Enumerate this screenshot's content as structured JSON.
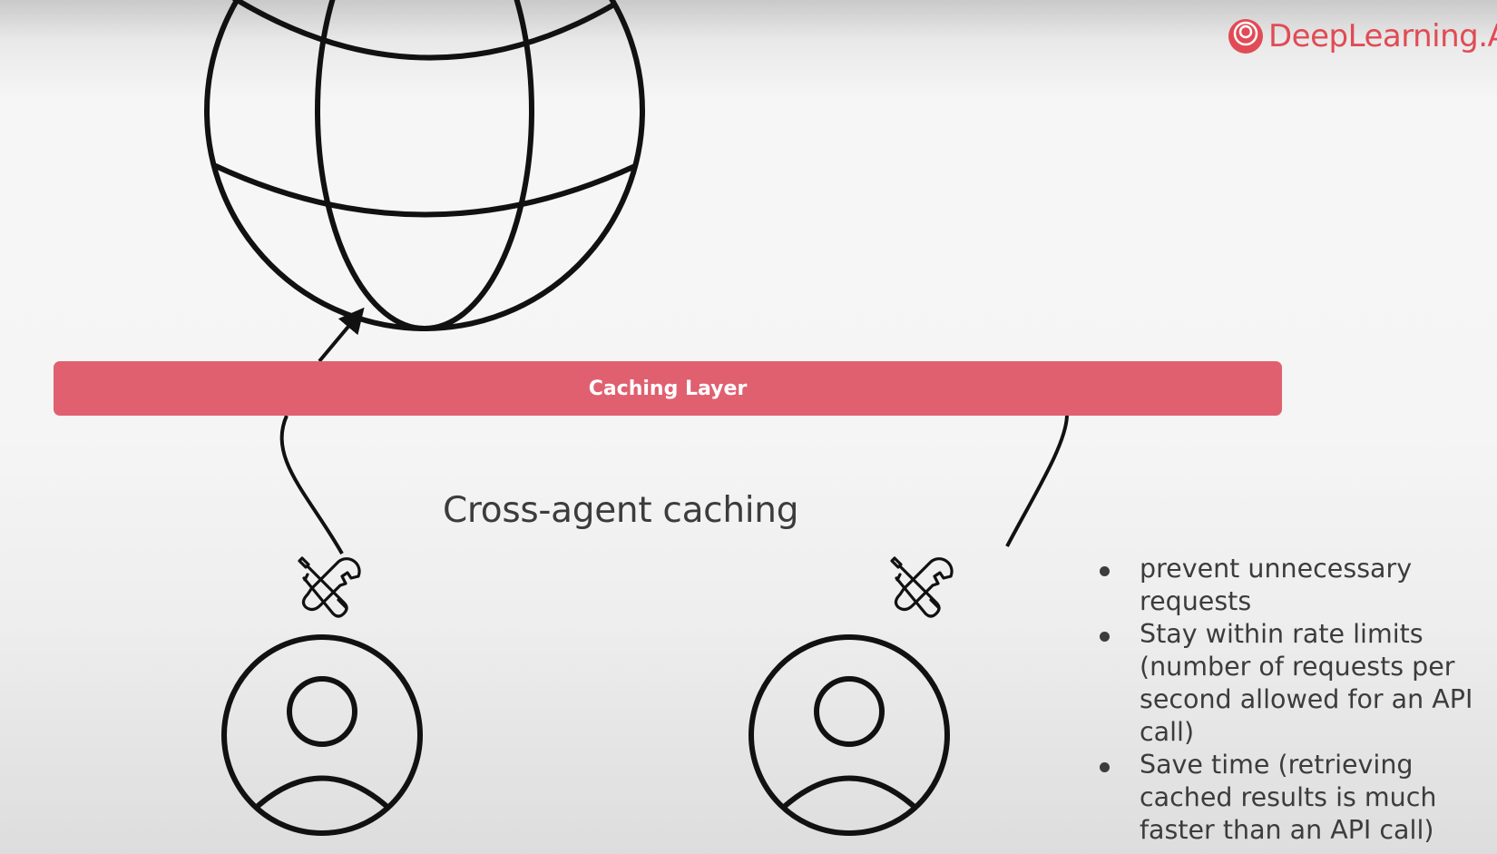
{
  "brand": {
    "name": "DeepLearning.AI",
    "color": "#e14b55"
  },
  "diagram": {
    "caching_layer_label": "Caching Layer",
    "subtitle": "Cross-agent caching",
    "icons": [
      "globe-icon",
      "tools-icon",
      "user-icon"
    ]
  },
  "bullets": [
    "prevent unnecessary requests",
    "Stay within rate limits (number of requests per second allowed for an API call)",
    "Save time (retrieving cached results is much faster than an API call)"
  ],
  "colors": {
    "caching_bar": "#e06070",
    "stroke": "#111111",
    "text": "#3c3c3c"
  }
}
